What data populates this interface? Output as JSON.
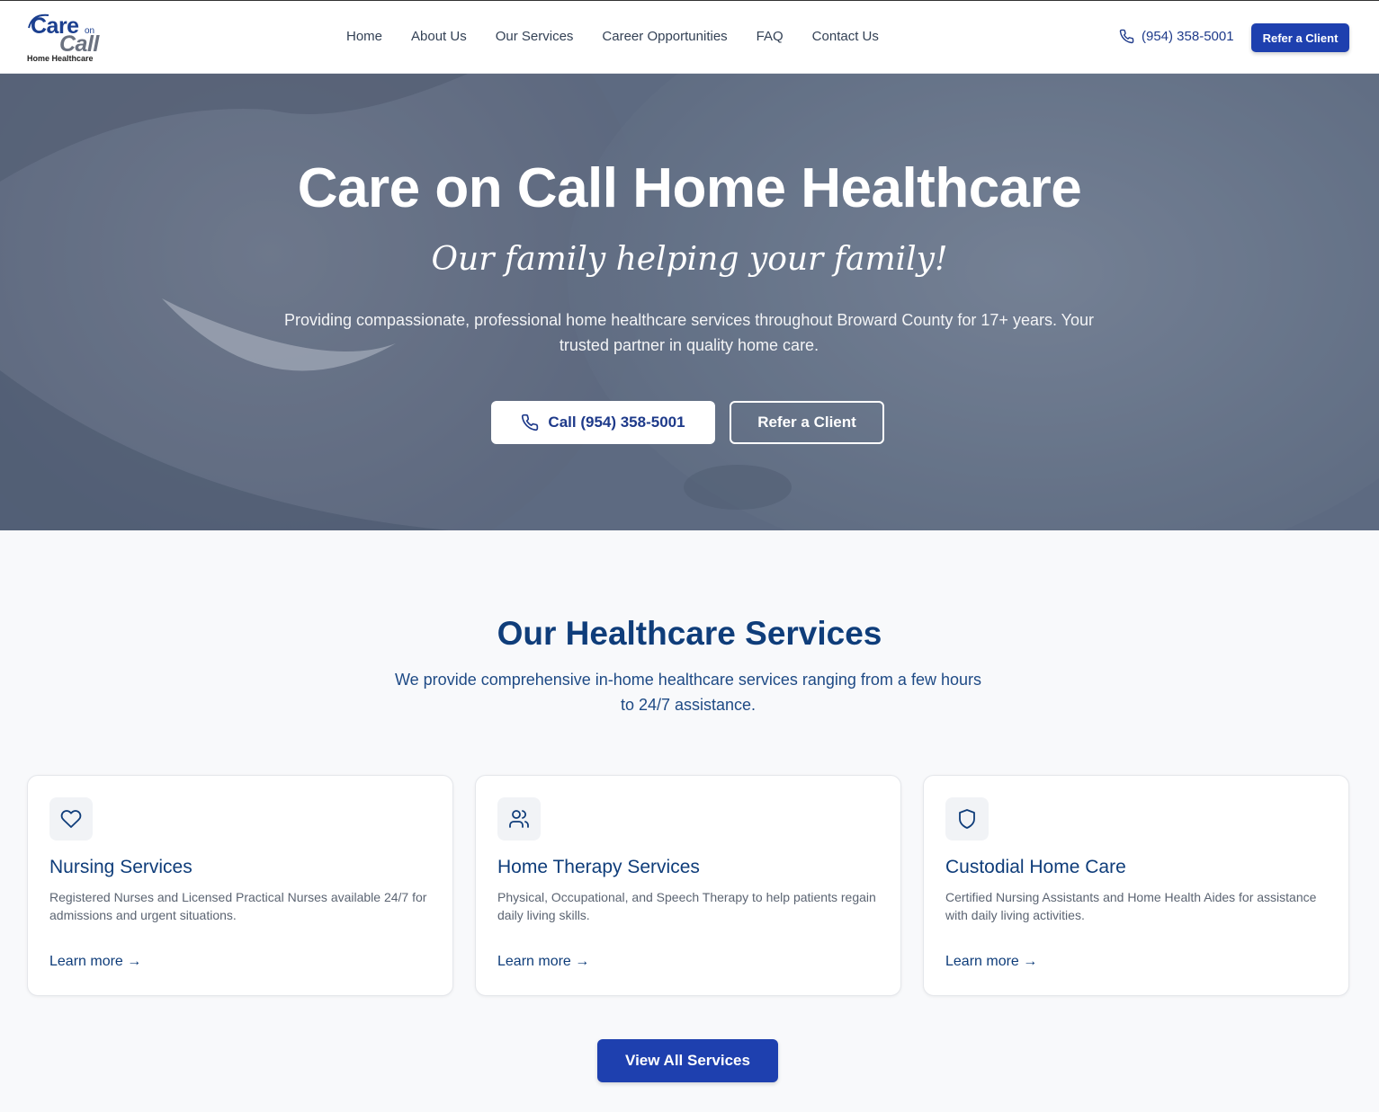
{
  "brand": {
    "care": "Care",
    "on": "on",
    "call": "Call",
    "sub": "Home Healthcare"
  },
  "nav": {
    "items": [
      {
        "label": "Home"
      },
      {
        "label": "About Us"
      },
      {
        "label": "Our Services"
      },
      {
        "label": "Career Opportunities"
      },
      {
        "label": "FAQ"
      },
      {
        "label": "Contact Us"
      }
    ]
  },
  "header": {
    "phone": "(954) 358-5001",
    "refer_label": "Refer a Client"
  },
  "hero": {
    "title": "Care on Call Home Healthcare",
    "tagline": "Our family helping your family!",
    "description": "Providing compassionate, professional home healthcare services throughout Broward County for 17+ years. Your trusted partner in quality home care.",
    "call_label": "Call (954) 358-5001",
    "refer_label": "Refer a Client"
  },
  "services": {
    "title": "Our Healthcare Services",
    "subtitle": "We provide comprehensive in-home healthcare services ranging from a few hours to 24/7 assistance.",
    "cards": [
      {
        "icon": "heart-icon",
        "title": "Nursing Services",
        "description": "Registered Nurses and Licensed Practical Nurses available 24/7 for admissions and urgent situations.",
        "link": "Learn more →"
      },
      {
        "icon": "users-icon",
        "title": "Home Therapy Services",
        "description": "Physical, Occupational, and Speech Therapy to help patients regain daily living skills.",
        "link": "Learn more →"
      },
      {
        "icon": "shield-icon",
        "title": "Custodial Home Care",
        "description": "Certified Nursing Assistants and Home Health Aides for assistance with daily living activities.",
        "link": "Learn more →"
      }
    ],
    "view_all_label": "View All Services"
  },
  "colors": {
    "primary": "#1e40af",
    "heading": "#0f3d7a",
    "page_bg": "#f8f9fb"
  }
}
